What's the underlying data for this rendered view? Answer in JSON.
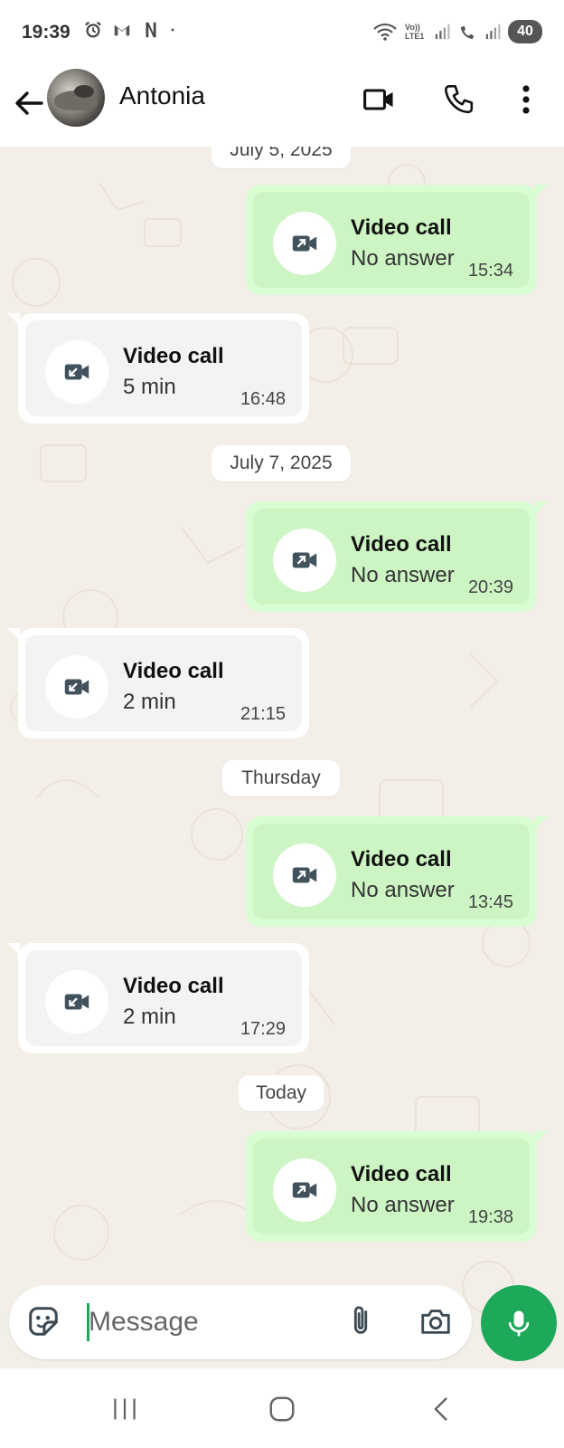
{
  "status_bar": {
    "time": "19:39",
    "battery": "40",
    "network_label": "Vo)) LTE1"
  },
  "header": {
    "contact_name": "Antonia"
  },
  "date_separators": [
    "July 5, 2025",
    "July 7, 2025",
    "Thursday",
    "Today"
  ],
  "messages": [
    {
      "direction": "outgoing",
      "title": "Video call",
      "status": "No answer",
      "time": "15:34"
    },
    {
      "direction": "incoming",
      "title": "Video call",
      "status": "5 min",
      "time": "16:48"
    },
    {
      "direction": "outgoing",
      "title": "Video call",
      "status": "No answer",
      "time": "20:39"
    },
    {
      "direction": "incoming",
      "title": "Video call",
      "status": "2 min",
      "time": "21:15"
    },
    {
      "direction": "outgoing",
      "title": "Video call",
      "status": "No answer",
      "time": "13:45"
    },
    {
      "direction": "incoming",
      "title": "Video call",
      "status": "2 min",
      "time": "17:29"
    },
    {
      "direction": "outgoing",
      "title": "Video call",
      "status": "No answer",
      "time": "19:38"
    }
  ],
  "composer": {
    "placeholder": "Message"
  },
  "icons": {
    "back": "arrow-left-icon",
    "video": "video-camera-icon",
    "phone": "phone-icon",
    "menu": "more-vertical-icon",
    "outgoing_call": "outgoing-video-call-icon",
    "incoming_call": "incoming-video-call-icon",
    "sticker": "sticker-icon",
    "attach": "paperclip-icon",
    "camera": "camera-icon",
    "mic": "microphone-icon"
  },
  "colors": {
    "accent": "#1da85a",
    "outgoing_bubble": "#d9fdd3",
    "incoming_bubble": "#ffffff",
    "chat_bg": "#f3efe8"
  }
}
